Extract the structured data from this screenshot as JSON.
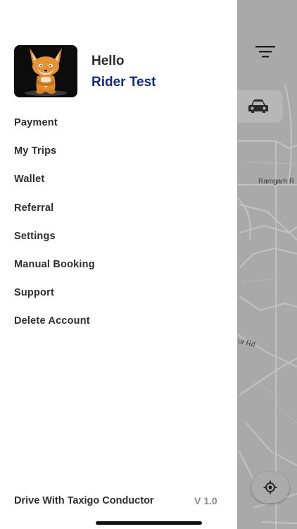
{
  "drawer": {
    "greeting": "Hello",
    "user_name": "Rider Test",
    "menu": [
      {
        "label": "Payment"
      },
      {
        "label": "My Trips"
      },
      {
        "label": "Wallet"
      },
      {
        "label": "Referral"
      },
      {
        "label": "Settings"
      },
      {
        "label": "Manual Booking"
      },
      {
        "label": "Support"
      },
      {
        "label": "Delete Account"
      }
    ],
    "footer_link": "Drive With Taxigo Conductor",
    "version": "V 1.0"
  },
  "map": {
    "labels": {
      "road_1": "Ramgarh R",
      "road_2": "ur Rd"
    },
    "icons": {
      "filter": "filter-icon",
      "car": "car-icon",
      "locate": "locate-icon"
    }
  },
  "colors": {
    "drawer_bg": "#ffffff",
    "username": "#17277a",
    "menu_text": "#2d2d2d",
    "version_text": "#8a8a8a",
    "map_bg": "#a9a9a9"
  }
}
